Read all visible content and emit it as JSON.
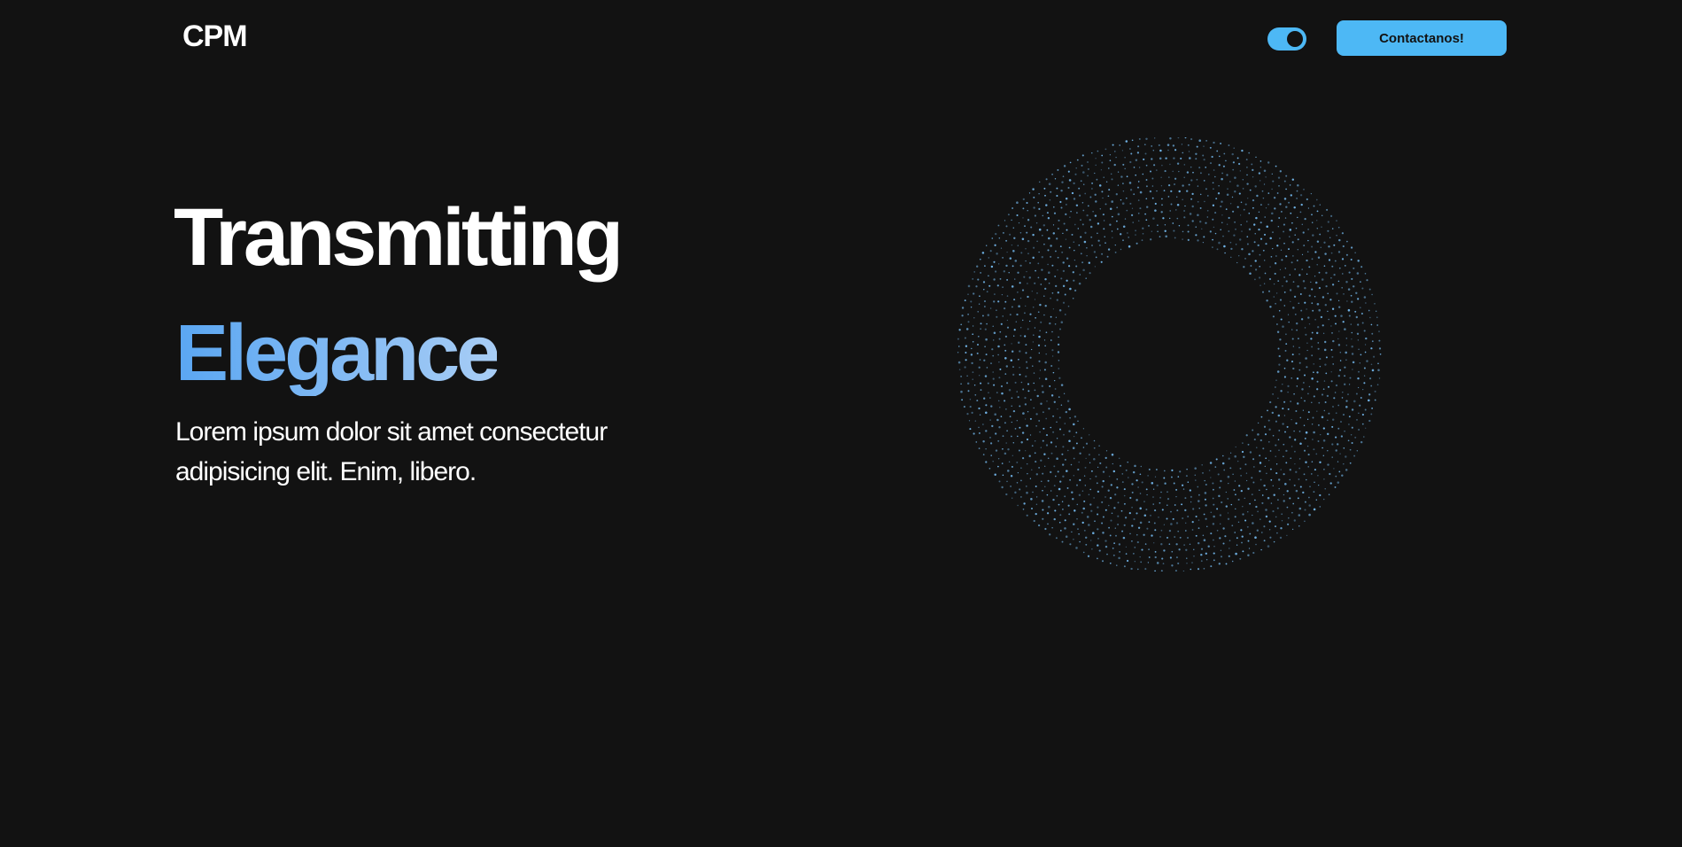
{
  "header": {
    "logo_text": "CPM",
    "theme_toggle": {
      "state": "on"
    },
    "cta_label": "Contactanos!"
  },
  "hero": {
    "title_line_1": "Transmitting",
    "title_line_2": "Elegance",
    "subtitle": "Lorem ipsum dolor sit amet consectetur adipisicing elit. Enim, libero."
  },
  "colors": {
    "background": "#121212",
    "accent": "#4db8f5",
    "gradient_start": "#5aa6f2",
    "gradient_end": "#a8cdf5",
    "dot_color": "#7cc6ff"
  },
  "icons": {
    "theme_toggle": "toggle-switch-icon",
    "decoration": "dotted-ring-graphic"
  }
}
